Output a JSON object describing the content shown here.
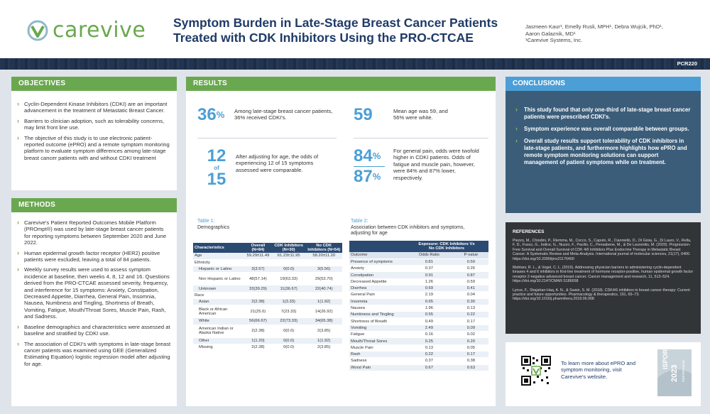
{
  "header": {
    "logo_text": "carevive",
    "title": "Symptom Burden in Late-Stage Breast Cancer Patients Treated with CDK Inhibitors Using the PRO-CTCAE",
    "authors": [
      "Jasmeen Kaur¹, Emelly Rusli, MPH¹, Debra Wujcik, PhD¹,",
      "Aaron Galaznik, MD¹",
      "¹Carevive Systems, Inc."
    ],
    "code": "PCR220"
  },
  "objectives": {
    "heading": "OBJECTIVES",
    "items": [
      "Cyclin-Dependent Kinase Inhibitors (CDKI) are an important advancement in the treatment of Metastatic Breast Cancer.",
      "Barriers to clinician adoption, such as tolerability concerns, may limit front line use.",
      "The objective of this study is to use electronic patient-reported outcome (ePRO) and a remote symptom monitoring platform to evaluate symptom differences among late-stage breast cancer patients with and without CDKI treatment"
    ]
  },
  "methods": {
    "heading": "METHODS",
    "items": [
      "Carevive's Patient Reported Outcomes Mobile Platform (PROmpt®) was used by late-stage breast cancer patients for reporting symptoms between September 2020 and June 2022.",
      "Human epidermal growth factor receptor (HER2) positive patients were excluded, leaving a total of 84 patients.",
      "Weekly survey results were used to assess symptom incidence at baseline, then weeks 4, 8, 12 and 16. Questions derived from the PRO-CTCAE assessed severity, frequency, and interference for 15 symptoms: Anxiety, Constipation, Decreased Appetite, Diarrhea, General Pain, Insomnia, Nausea, Numbness and Tingling, Shortness of Breath, Vomiting, Fatigue, Mouth/Throat Sores, Muscle Pain, Rash, and Sadness.",
      "Baseline demographics and characteristics were assessed at baseline and stratified by CDKI use.",
      "The association of CDKI's with symptoms in late-stage breast cancer patients was examined using GEE (Generalized Estimating Equation) logistic regression model after adjusting for age."
    ]
  },
  "results": {
    "heading": "RESULTS",
    "stat1": {
      "num": "36",
      "unit": "%",
      "text": "Among late-stage breast cancer patients, 36% received CDKI's."
    },
    "stat2": {
      "num": "59",
      "text": "Mean age was 59, and 56% were white."
    },
    "stat3": {
      "num_a": "12",
      "of": "of",
      "num_b": "15",
      "text": "After adjusting for age, the odds of experiencing 12 of 15 symptoms assessed were comparable."
    },
    "stat4": {
      "num_a": "84",
      "num_b": "87",
      "unit": "%",
      "text": "For general pain, odds were twofold higher in CDKI patients. Odds of fatigue and muscle pain, however, were 84% and 87% lower, respectively."
    }
  },
  "table1": {
    "label": "Table 1:",
    "caption": "Demographics",
    "headers": [
      "Characteristics",
      "Overall (N=84)",
      "CDK Inhibitors (N=30)",
      "No CDK Inhibitors (N=54)"
    ],
    "rows": [
      [
        "Age",
        "59.29±11.49",
        "61.23±11.95",
        "58.20±11.20"
      ],
      [
        "Ethnicity",
        "",
        "",
        ""
      ],
      [
        "Hispanic or Latino",
        "3(3.57)",
        "0(0.0)",
        "3(5.56)"
      ],
      [
        "Non Hispanic or Latino",
        "48(57.14)",
        "19(63.33)",
        "29(53.70)"
      ],
      [
        "Unknown",
        "33(39.29)",
        "11(36.67)",
        "22(40.74)"
      ],
      [
        "Race",
        "",
        "",
        ""
      ],
      [
        "Asian",
        "2(2.38)",
        "1(3.33)",
        "1(1.92)"
      ],
      [
        "Black or African American",
        "21(25.0)",
        "7(23.33)",
        "14(26.92)"
      ],
      [
        "White",
        "56(66.67)",
        "22(73.33)",
        "34(65.38)"
      ],
      [
        "American Indian or Alaska Native",
        "2(2.38)",
        "0(0.0)",
        "2(3.85)"
      ],
      [
        "Other",
        "1(1.20)",
        "0(0.0)",
        "1(1.92)"
      ],
      [
        "Missing",
        "2(2.38)",
        "0(0.0)",
        "2(3.85)"
      ]
    ]
  },
  "table2": {
    "label": "Table 2:",
    "caption": "Association between CDK inhibitors and symptoms, adjusting for age",
    "group_header": "Exposure: CDK Inhibitors Vs No CDK Inhibitors",
    "sub_headers": [
      "Outcome",
      "Odds Ratio",
      "P-value"
    ],
    "rows": [
      [
        "Presence of symptoms",
        "0.81",
        "0.59"
      ],
      [
        "Anxiety",
        "0.37",
        "0.26"
      ],
      [
        "Constipation",
        "0.91",
        "0.87"
      ],
      [
        "Decreased Appetite",
        "1.26",
        "0.59"
      ],
      [
        "Diarrhea",
        "0.69",
        "0.41"
      ],
      [
        "General Pain",
        "2.19",
        "0.04"
      ],
      [
        "Insomnia",
        "0.65",
        "0.30"
      ],
      [
        "Nausea",
        "1.96",
        "0.13"
      ],
      [
        "Numbness and Tingling",
        "0.55",
        "0.22"
      ],
      [
        "Shortness of Breath",
        "0.49",
        "0.17"
      ],
      [
        "Vomiting",
        "2.49",
        "0.09"
      ],
      [
        "Fatigue",
        "0.16",
        "0.02"
      ],
      [
        "Mouth/Throat Sores",
        "0.25",
        "0.20"
      ],
      [
        "Muscle Pain",
        "0.13",
        "0.05"
      ],
      [
        "Rash",
        "0.22",
        "0.17"
      ],
      [
        "Sadness",
        "0.37",
        "0.38"
      ],
      [
        "Worst Pain",
        "0.67",
        "0.63"
      ]
    ]
  },
  "conclusions": {
    "heading": "CONCLUSIONS",
    "items": [
      "This study found that only one-third of late-stage breast cancer patients were prescribed CDKI's.",
      "Symptom experience was overall comparable between groups.",
      "Overall study results support tolerability of CDK inhibitors in late-stage patients, and furthermore highlights how ePRO and remote symptom monitoring solutions can support management of patient symptoms while on treatment."
    ]
  },
  "references": {
    "heading": "REFERENCES",
    "items": [
      "Piezzo, M., Chiodini, P., Riemma, M., Cocco, S., Caputo, R., Cianniello, D., Di Gioia, G., Di Lauro, V., Rella, F. D., Fusco, G., Iodice, G., Nuzzo, F., Pacilio, C., Pensabene, M., & De Laurentiis, M. (2020). Progression-Free Survival and Overall Survival of CDK 4/6 Inhibitors Plus Endocrine Therapy in Metastatic Breast Cancer: A Systematic Review and Meta-Analysis. International journal of molecular sciences, 21(17), 6400. https://doi.org/10.3390/ijms21176400",
      "Mahtani, R. L., & Vogel, C. L. (2019). Addressing physician barriers to administering cyclin-dependent kinases 4 and 6 inhibitors in first-line treatment of hormone receptor-positive, human epidermal growth factor receptor 2-negative advanced breast cancer. Cancer management and research, 11, 513–524. https://doi.org/10.2147/CMAR.S186658",
      "Lynce, F., Shajahan-Haq, A. N., & Swain, S. M. (2018). CDK4/6 inhibitors in breast cancer therapy: Current practice and future opportunities. Pharmacology & therapeutics, 191, 65–73. https://doi.org/10.1016/j.pharmthera.2018.06.008"
    ]
  },
  "learn_more": {
    "text": "To learn more about ePRO and symptom monitoring, visit Carevive's website.",
    "badge_line1": "ISPOR",
    "badge_line2": "2023",
    "badge_line3": "#ISPORAnnual"
  },
  "colors": {
    "green": "#6aa84f",
    "blue": "#4b9fd6",
    "navy": "#1f3b68",
    "slate": "#3b5d79"
  }
}
